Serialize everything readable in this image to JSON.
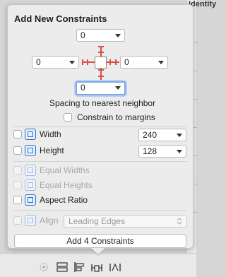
{
  "background": {
    "right_panel_title": "Identity"
  },
  "popover": {
    "title": "Add New Constraints",
    "spacing": {
      "top": "0",
      "left": "0",
      "right": "0",
      "bottom": "0"
    },
    "spacing_caption": "Spacing to nearest neighbor",
    "constrain_margins_label": "Constrain to margins",
    "width": {
      "label": "Width",
      "value": "240"
    },
    "height": {
      "label": "Height",
      "value": "128"
    },
    "equal_widths_label": "Equal Widths",
    "equal_heights_label": "Equal Heights",
    "aspect_ratio_label": "Aspect Ratio",
    "align": {
      "label": "Align",
      "value": "Leading Edges"
    },
    "add_button_label": "Add 4 Constraints"
  },
  "colors": {
    "accent": "#2a6fc9",
    "strut": "#e04a4a",
    "focus_ring": "#7fa7e6"
  },
  "bottom_toolbar": {
    "icons": [
      "update-frames-icon",
      "stack-icon",
      "align-icon",
      "pin-icon",
      "resolve-issues-icon"
    ]
  }
}
